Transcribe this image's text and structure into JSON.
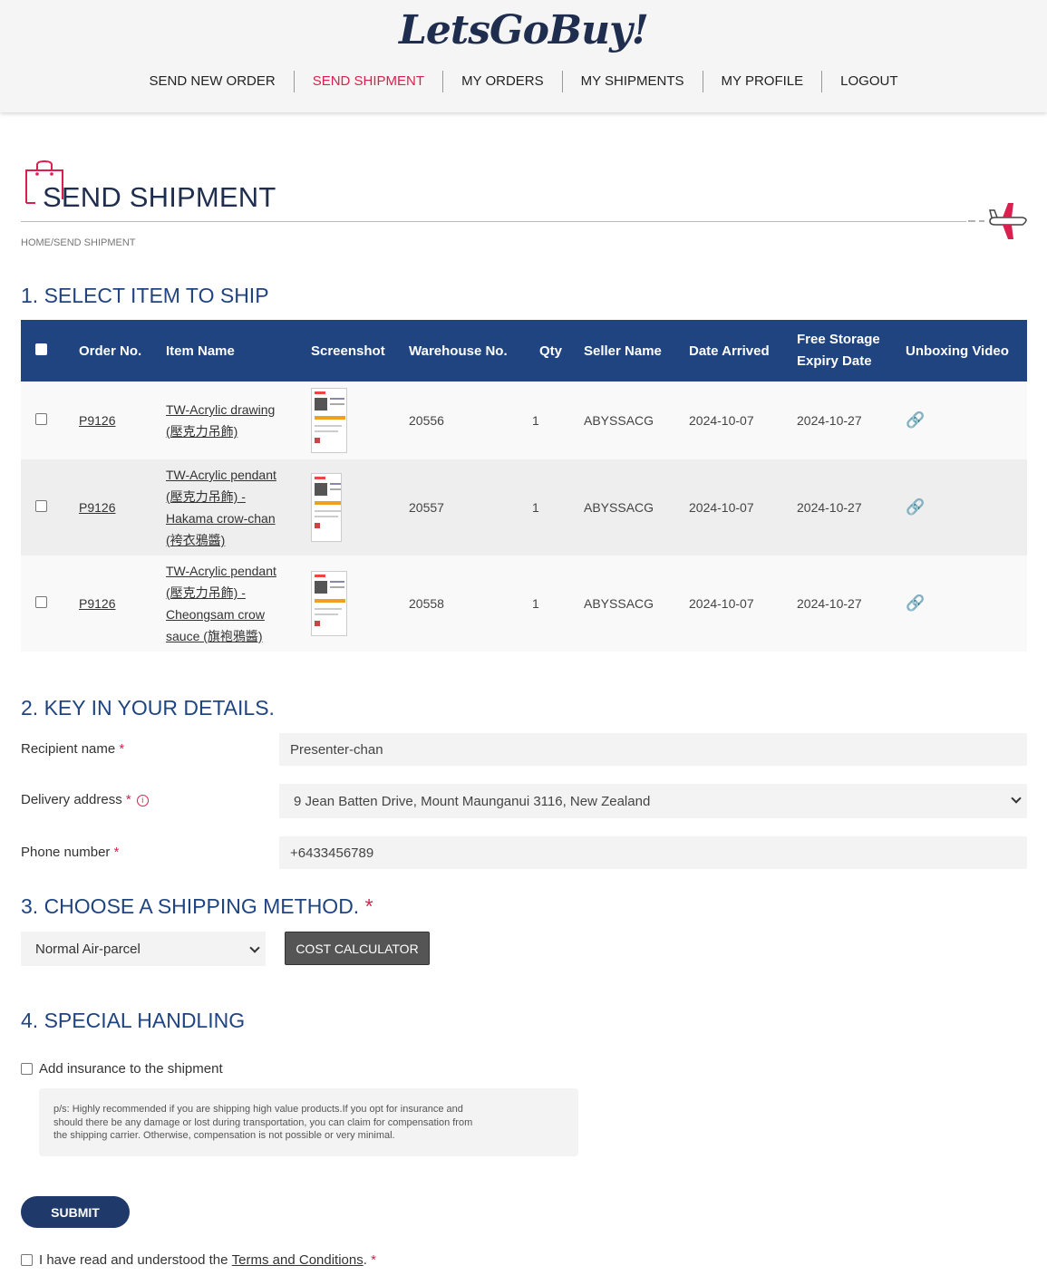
{
  "brand": {
    "logo_text": "LetsGoBuy!"
  },
  "nav": [
    {
      "label": "SEND NEW ORDER",
      "active": false
    },
    {
      "label": "SEND SHIPMENT",
      "active": true
    },
    {
      "label": "MY ORDERS",
      "active": false
    },
    {
      "label": "MY SHIPMENTS",
      "active": false
    },
    {
      "label": "MY PROFILE",
      "active": false
    },
    {
      "label": "LOGOUT",
      "active": false
    }
  ],
  "page": {
    "title": "SEND SHIPMENT",
    "breadcrumb": "HOME/SEND SHIPMENT"
  },
  "section1": {
    "title": "1. SELECT ITEM TO SHIP",
    "headers": {
      "order": "Order No.",
      "item": "Item Name",
      "screenshot": "Screenshot",
      "warehouse": "Warehouse No.",
      "qty": "Qty",
      "seller": "Seller Name",
      "arrived": "Date Arrived",
      "expiry_1": "Free Storage",
      "expiry_2": "Expiry Date",
      "video": "Unboxing Video"
    },
    "rows": [
      {
        "order": "P9126",
        "item_lines": [
          "TW-Acrylic drawing",
          "(壓克力吊飾)"
        ],
        "warehouse": "20556",
        "qty": "1",
        "seller": "ABYSSACG",
        "arrived": "2024-10-07",
        "expiry": "2024-10-27",
        "video_icon": "link-icon"
      },
      {
        "order": "P9126",
        "item_lines": [
          "TW-Acrylic pendant",
          "(壓克力吊飾) -",
          "Hakama crow-chan",
          "(袴衣鴉醬)"
        ],
        "warehouse": "20557",
        "qty": "1",
        "seller": "ABYSSACG",
        "arrived": "2024-10-07",
        "expiry": "2024-10-27",
        "video_icon": "link-icon"
      },
      {
        "order": "P9126",
        "item_lines": [
          "TW-Acrylic pendant",
          "(壓克力吊飾) -",
          "Cheongsam crow",
          "sauce (旗袍鴉醬)"
        ],
        "warehouse": "20558",
        "qty": "1",
        "seller": "ABYSSACG",
        "arrived": "2024-10-07",
        "expiry": "2024-10-27",
        "video_icon": "link-icon"
      }
    ]
  },
  "section2": {
    "title": "2. KEY IN YOUR DETAILS.",
    "recipient_label": "Recipient name",
    "recipient_value": "Presenter-chan",
    "address_label": "Delivery address",
    "address_value": "9 Jean Batten Drive, Mount Maunganui 3116, New Zealand",
    "phone_label": "Phone number",
    "phone_value": "+6433456789",
    "required_mark": "*"
  },
  "section3": {
    "title": "3. CHOOSE A SHIPPING METHOD.",
    "required_mark": "*",
    "method_value": "Normal Air-parcel",
    "calc_label": "COST CALCULATOR"
  },
  "section4": {
    "title": "4. SPECIAL HANDLING",
    "insurance_label": "Add insurance to the shipment",
    "note_lines": [
      "p/s: Highly recommended if you are shipping high value products.If you opt for insurance and",
      "should there be any damage or lost during transportation, you can claim for compensation from",
      "the shipping carrier. Otherwise, compensation is not possible or very minimal."
    ]
  },
  "submit_label": "SUBMIT",
  "terms": {
    "prefix": "I have read and understood the ",
    "link": "Terms and Conditions",
    "suffix": ".",
    "required_mark": "*"
  },
  "colors": {
    "primary": "#1f4480",
    "accent": "#d9204f",
    "header_bg": "#f5f5f5"
  }
}
